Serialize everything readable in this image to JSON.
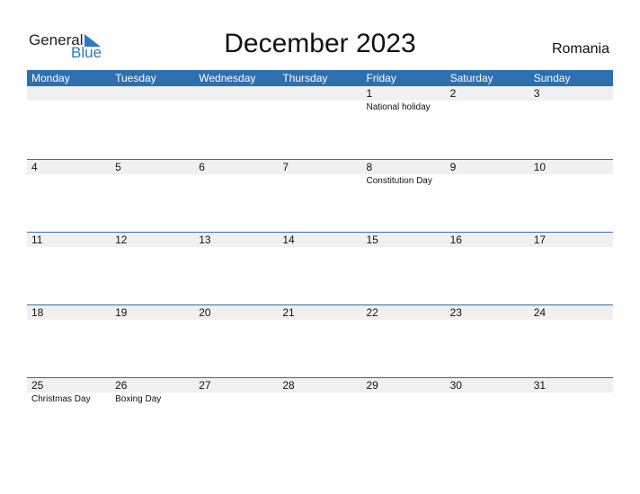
{
  "logo": {
    "general": "General",
    "blue": "Blue"
  },
  "title": "December 2023",
  "country": "Romania",
  "colors": {
    "accent": "#2e6fb0",
    "daybar": "#f0f0f0"
  },
  "days": [
    "Monday",
    "Tuesday",
    "Wednesday",
    "Thursday",
    "Friday",
    "Saturday",
    "Sunday"
  ],
  "weeks": [
    [
      {
        "d": "",
        "h": ""
      },
      {
        "d": "",
        "h": ""
      },
      {
        "d": "",
        "h": ""
      },
      {
        "d": "",
        "h": ""
      },
      {
        "d": "1",
        "h": "National holiday"
      },
      {
        "d": "2",
        "h": ""
      },
      {
        "d": "3",
        "h": ""
      }
    ],
    [
      {
        "d": "4",
        "h": ""
      },
      {
        "d": "5",
        "h": ""
      },
      {
        "d": "6",
        "h": ""
      },
      {
        "d": "7",
        "h": ""
      },
      {
        "d": "8",
        "h": "Constitution Day"
      },
      {
        "d": "9",
        "h": ""
      },
      {
        "d": "10",
        "h": ""
      }
    ],
    [
      {
        "d": "11",
        "h": ""
      },
      {
        "d": "12",
        "h": ""
      },
      {
        "d": "13",
        "h": ""
      },
      {
        "d": "14",
        "h": ""
      },
      {
        "d": "15",
        "h": ""
      },
      {
        "d": "16",
        "h": ""
      },
      {
        "d": "17",
        "h": ""
      }
    ],
    [
      {
        "d": "18",
        "h": ""
      },
      {
        "d": "19",
        "h": ""
      },
      {
        "d": "20",
        "h": ""
      },
      {
        "d": "21",
        "h": ""
      },
      {
        "d": "22",
        "h": ""
      },
      {
        "d": "23",
        "h": ""
      },
      {
        "d": "24",
        "h": ""
      }
    ],
    [
      {
        "d": "25",
        "h": "Christmas Day"
      },
      {
        "d": "26",
        "h": "Boxing Day"
      },
      {
        "d": "27",
        "h": ""
      },
      {
        "d": "28",
        "h": ""
      },
      {
        "d": "29",
        "h": ""
      },
      {
        "d": "30",
        "h": ""
      },
      {
        "d": "31",
        "h": ""
      }
    ]
  ]
}
